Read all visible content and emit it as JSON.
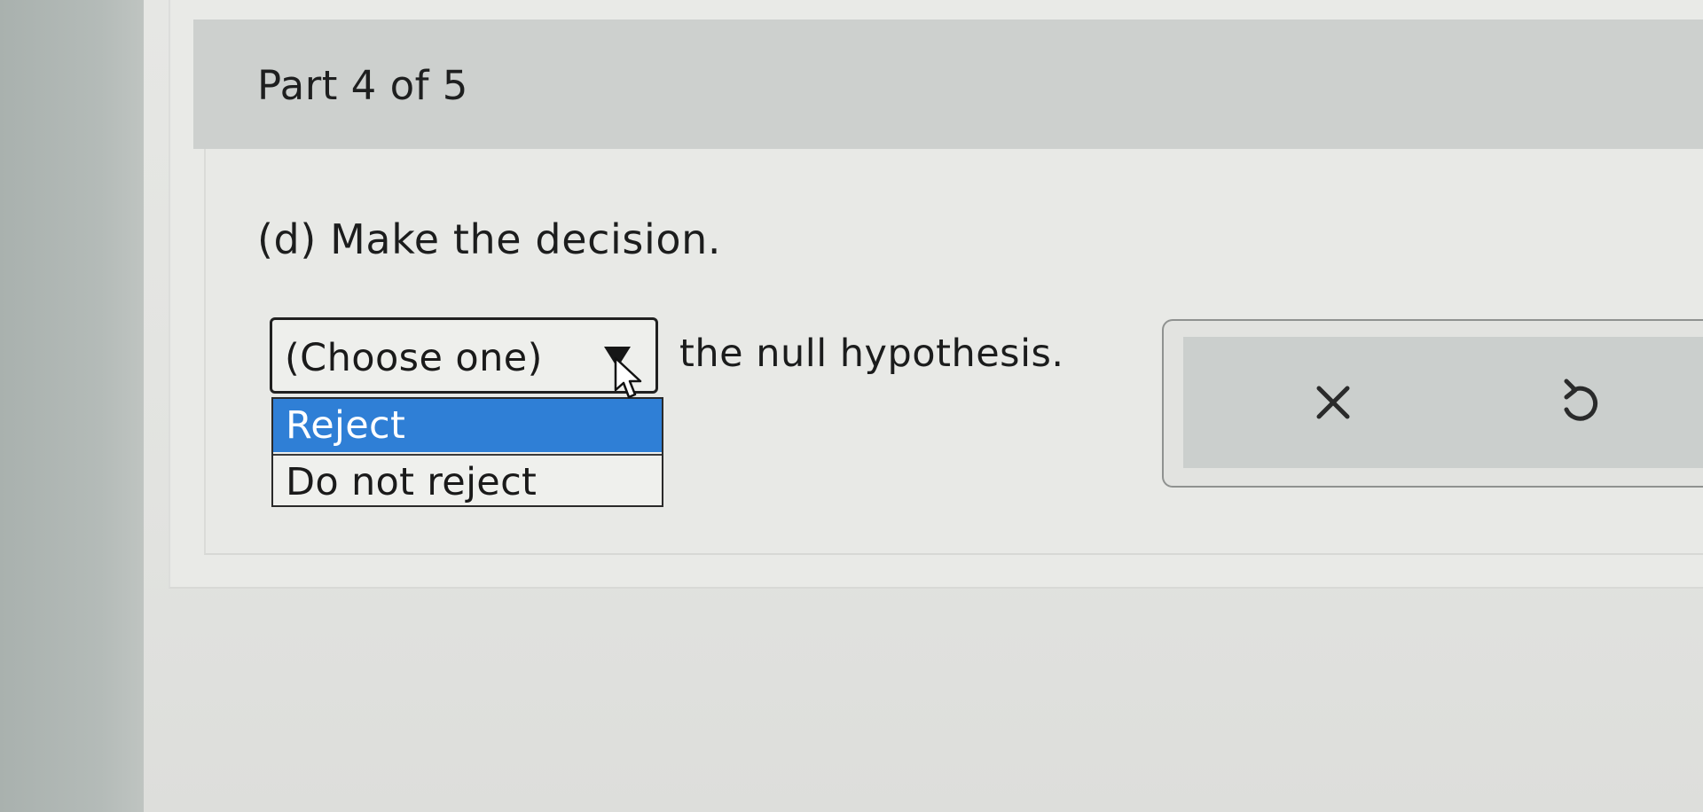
{
  "part": {
    "title": "Part 4 of 5"
  },
  "question": {
    "prompt": "(d) Make the decision.",
    "after_select": "the null hypothesis."
  },
  "select": {
    "current_value": "(Choose one)",
    "options": [
      "Reject",
      "Do not reject"
    ],
    "highlighted_index": 0
  },
  "actions": {
    "clear_icon": "close-icon",
    "undo_icon": "undo-icon"
  },
  "colors": {
    "highlight": "#2f7fd6",
    "header_bg": "#cdd0ce"
  }
}
